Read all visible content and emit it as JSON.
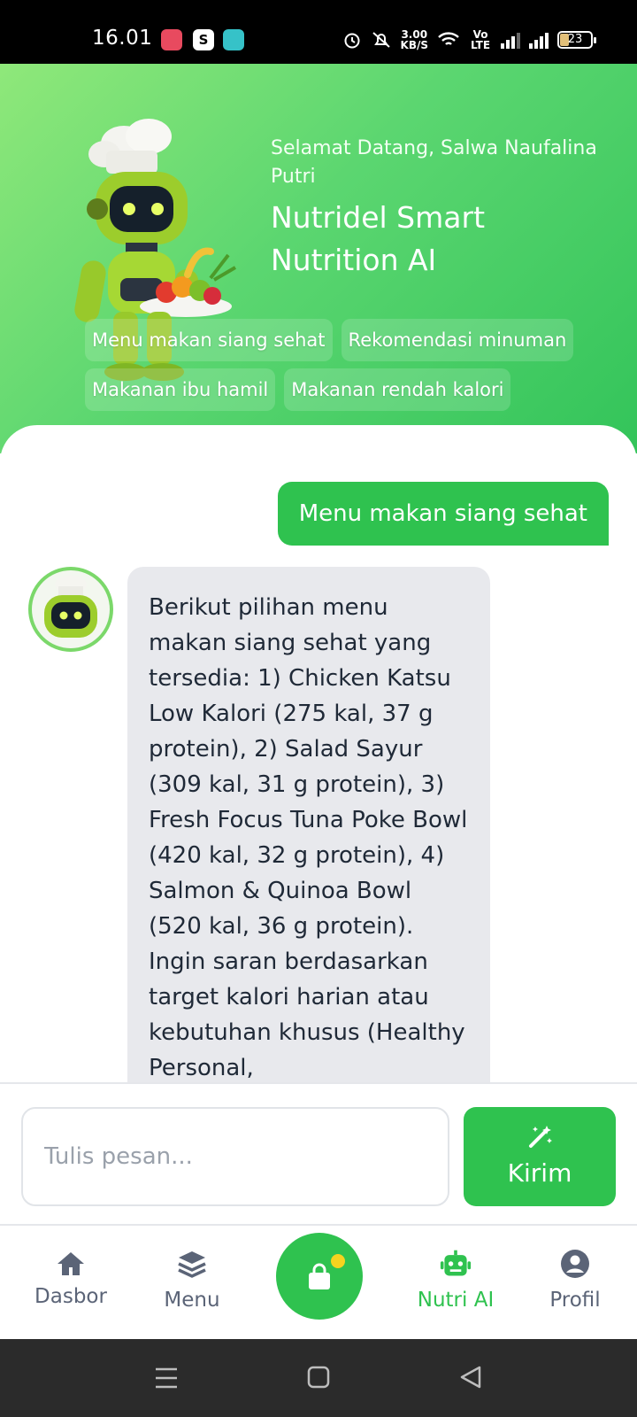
{
  "status_bar": {
    "time": "16.01",
    "net_speed_value": "3.00",
    "net_speed_unit": "KB/S",
    "volte": "Vo LTE",
    "battery": "23"
  },
  "header": {
    "welcome": "Selamat Datang, Salwa Naufalina Putri",
    "title": "Nutridel Smart Nutrition AI",
    "chips": [
      "Menu makan siang sehat",
      "Rekomendasi minuman",
      "Makanan ibu hamil",
      "Makanan rendah kalori"
    ]
  },
  "chat": {
    "user_message": "Menu makan siang sehat",
    "bot_message": "Berikut pilihan menu makan siang sehat yang tersedia: 1) Chicken Katsu Low Kalori (275 kal, 37 g protein), 2) Salad Sayur (309 kal, 31 g protein), 3) Fresh Focus Tuna Poke Bowl (420 kal, 32 g protein), 4) Salmon & Quinoa Bowl (520 kal, 36 g protein). Ingin saran berdasarkan target kalori harian atau kebutuhan khusus (Healthy Personal,"
  },
  "composer": {
    "placeholder": "Tulis pesan...",
    "send_label": "Kirim"
  },
  "bottom_nav": {
    "items": [
      {
        "label": "Dasbor",
        "icon": "home-icon"
      },
      {
        "label": "Menu",
        "icon": "layers-icon"
      },
      {
        "label": "",
        "icon": "shopping-bag-icon"
      },
      {
        "label": "Nutri AI",
        "icon": "robot-icon"
      },
      {
        "label": "Profil",
        "icon": "user-circle-icon"
      }
    ],
    "active": "Nutri AI"
  },
  "colors": {
    "brand_green": "#2fc24f",
    "hero_light": "#8fe87a",
    "bubble_gray": "#e8e9ed",
    "nav_inactive": "#5b6477",
    "badge_yellow": "#f5d31f"
  }
}
